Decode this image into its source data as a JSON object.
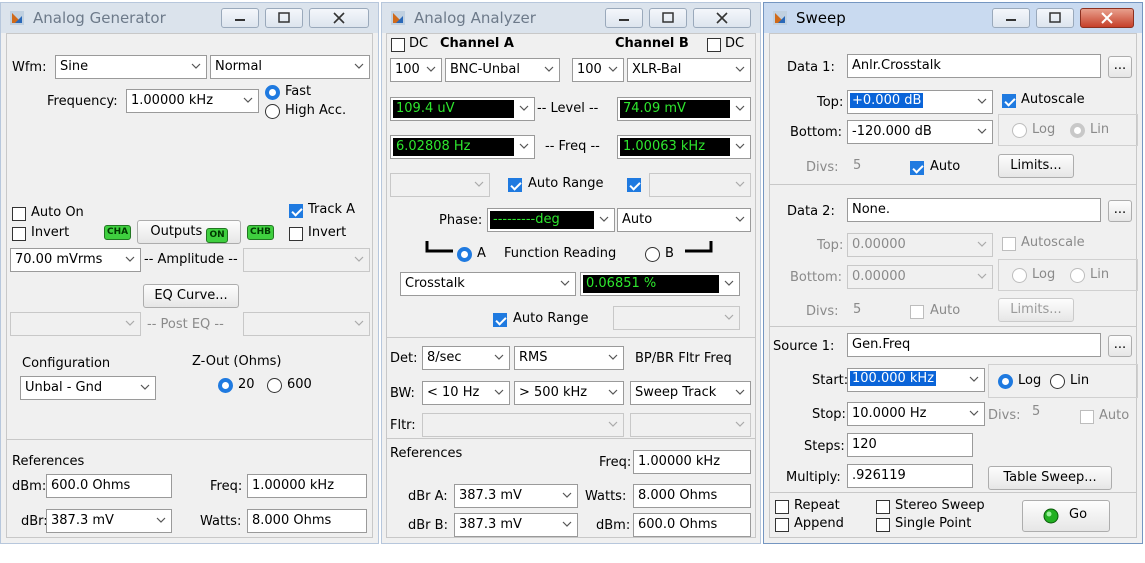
{
  "generator": {
    "title": "Analog Generator",
    "wfm_label": "Wfm:",
    "wfm_value": "Sine",
    "mode_value": "Normal",
    "frequency_label": "Frequency:",
    "frequency_value": "1.00000 kHz",
    "fast_label": "Fast",
    "high_acc_label": "High Acc.",
    "auto_on_label": "Auto On",
    "track_a_label": "Track A",
    "invert_label_a": "Invert",
    "invert_label_b": "Invert",
    "cha_badge": "CHA",
    "chb_badge": "CHB",
    "outputs_label": "Outputs",
    "on_badge": "ON",
    "amplitude_value": "70.00  mVrms",
    "amplitude_label": "-- Amplitude --",
    "eq_curve_label": "EQ Curve...",
    "post_eq_label": "-- Post EQ --",
    "configuration_label": "Configuration",
    "configuration_value": "Unbal - Gnd",
    "zout_label": "Z-Out (Ohms)",
    "zout_20": "20",
    "zout_600": "600",
    "references_label": "References",
    "dbm_label": "dBm:",
    "dbm_value": "600.0   Ohms",
    "freq_label": "Freq:",
    "freq_value": "1.00000 kHz",
    "dbr_label": "dBr:",
    "dbr_value": "387.3  mV",
    "watts_label": "Watts:",
    "watts_value": "8.000   Ohms"
  },
  "analyzer": {
    "title": "Analog Analyzer",
    "dc_label_a": "DC",
    "channel_a": "Channel A",
    "channel_b": "Channel B",
    "dc_label_b": "DC",
    "range_a": "100l",
    "input_a": "BNC-Unbal",
    "range_b": "100l",
    "input_b": "XLR-Bal",
    "level_a": "109.4  uV",
    "level_label": "-- Level --",
    "level_b": "74.09  mV",
    "freq_a": "6.02808  Hz",
    "freq_label": "-- Freq --",
    "freq_b": "1.00063 kHz",
    "auto_range_label": "Auto Range",
    "phase_label": "Phase:",
    "phase_value": "---------deg",
    "phase_mode": "Auto",
    "a_label": "A",
    "function_reading_label": "Function Reading",
    "b_label": "B",
    "function_value": "Crosstalk",
    "function_reading_value": "0.06851  %",
    "auto_range2_label": "Auto Range",
    "det_label": "Det:",
    "det_value": "8/sec",
    "det_mode": "RMS",
    "bpbr_label": "BP/BR Fltr Freq",
    "bw_label": "BW:",
    "bw_low": "< 10 Hz",
    "bw_high": "> 500 kHz",
    "bpbr_value": "Sweep Track",
    "fltr_label": "Fltr:",
    "references_label": "References",
    "freq_ref_label": "Freq:",
    "freq_ref_value": "1.00000 kHz",
    "dbra_label": "dBr A:",
    "dbra_value": "387.3  mV",
    "watts_label": "Watts:",
    "watts_value": "8.000   Ohms",
    "dbrb_label": "dBr B:",
    "dbrb_value": "387.3  mV",
    "dbm_label": "dBm:",
    "dbm_value": "600.0   Ohms"
  },
  "sweep": {
    "title": "Sweep",
    "data1_label": "Data 1:",
    "data1_value": "Anlr.Crosstalk",
    "top_label": "Top:",
    "top_value": "+0.000  dB",
    "autoscale_label": "Autoscale",
    "bottom_label": "Bottom:",
    "bottom_value": "-120.000 dB",
    "log_label": "Log",
    "lin_label": "Lin",
    "divs_label": "Divs:",
    "divs_value": "5",
    "auto_label": "Auto",
    "limits_label": "Limits...",
    "data2_label": "Data 2:",
    "data2_value": "None.",
    "top2_value": "0.00000",
    "bottom2_value": "0.00000",
    "divs2_value": "5",
    "source1_label": "Source 1:",
    "source1_value": "Gen.Freq",
    "start_label": "Start:",
    "start_value": "100.000 kHz",
    "stop_label": "Stop:",
    "stop_value": "10.0000  Hz",
    "src_divs_label": "Divs:",
    "src_divs_value": "5",
    "steps_label": "Steps:",
    "steps_value": "120",
    "multiply_label": "Multiply:",
    "multiply_value": ".926119",
    "table_sweep_label": "Table Sweep...",
    "repeat_label": "Repeat",
    "stereo_sweep_label": "Stereo Sweep",
    "append_label": "Append",
    "single_point_label": "Single Point",
    "go_label": "Go",
    "browse_label": "..."
  }
}
